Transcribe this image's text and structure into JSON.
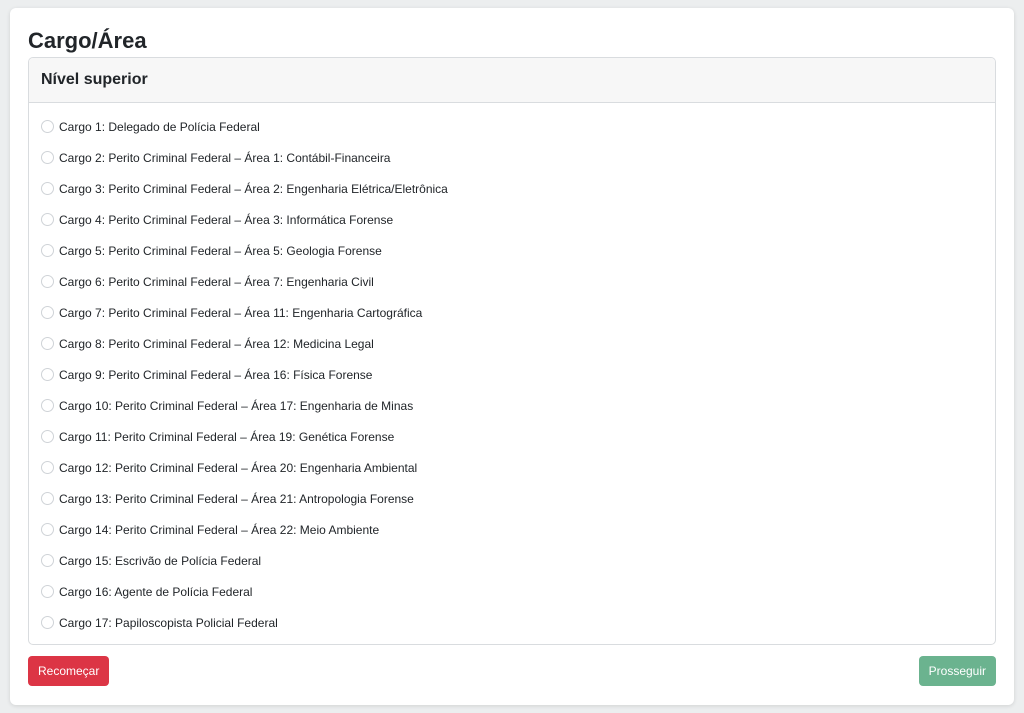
{
  "page": {
    "title": "Cargo/Área"
  },
  "panel": {
    "header": "Nível superior",
    "options": [
      {
        "label": "Cargo 1: Delegado de Polícia Federal",
        "selected": false
      },
      {
        "label": "Cargo 2: Perito Criminal Federal – Área 1: Contábil-Financeira",
        "selected": false
      },
      {
        "label": "Cargo 3: Perito Criminal Federal – Área 2: Engenharia Elétrica/Eletrônica",
        "selected": false
      },
      {
        "label": "Cargo 4: Perito Criminal Federal – Área 3: Informática Forense",
        "selected": false
      },
      {
        "label": "Cargo 5: Perito Criminal Federal – Área 5: Geologia Forense",
        "selected": false
      },
      {
        "label": "Cargo 6: Perito Criminal Federal – Área 7: Engenharia Civil",
        "selected": false
      },
      {
        "label": "Cargo 7: Perito Criminal Federal – Área 11: Engenharia Cartográfica",
        "selected": false
      },
      {
        "label": "Cargo 8: Perito Criminal Federal – Área 12: Medicina Legal",
        "selected": false
      },
      {
        "label": "Cargo 9: Perito Criminal Federal – Área 16: Física Forense",
        "selected": false
      },
      {
        "label": "Cargo 10: Perito Criminal Federal – Área 17: Engenharia de Minas",
        "selected": false
      },
      {
        "label": "Cargo 11: Perito Criminal Federal – Área 19: Genética Forense",
        "selected": false
      },
      {
        "label": "Cargo 12: Perito Criminal Federal – Área 20: Engenharia Ambiental",
        "selected": false
      },
      {
        "label": "Cargo 13: Perito Criminal Federal – Área 21: Antropologia Forense",
        "selected": false
      },
      {
        "label": "Cargo 14: Perito Criminal Federal – Área 22: Meio Ambiente",
        "selected": false
      },
      {
        "label": "Cargo 15: Escrivão de Polícia Federal",
        "selected": false
      },
      {
        "label": "Cargo 16: Agente de Polícia Federal",
        "selected": false
      },
      {
        "label": "Cargo 17: Papiloscopista Policial Federal",
        "selected": false
      }
    ]
  },
  "actions": {
    "restart_label": "Recomeçar",
    "next_label": "Prosseguir"
  },
  "colors": {
    "restart": "#dc3545",
    "next": "#6bb38f",
    "background": "#eceeef"
  }
}
